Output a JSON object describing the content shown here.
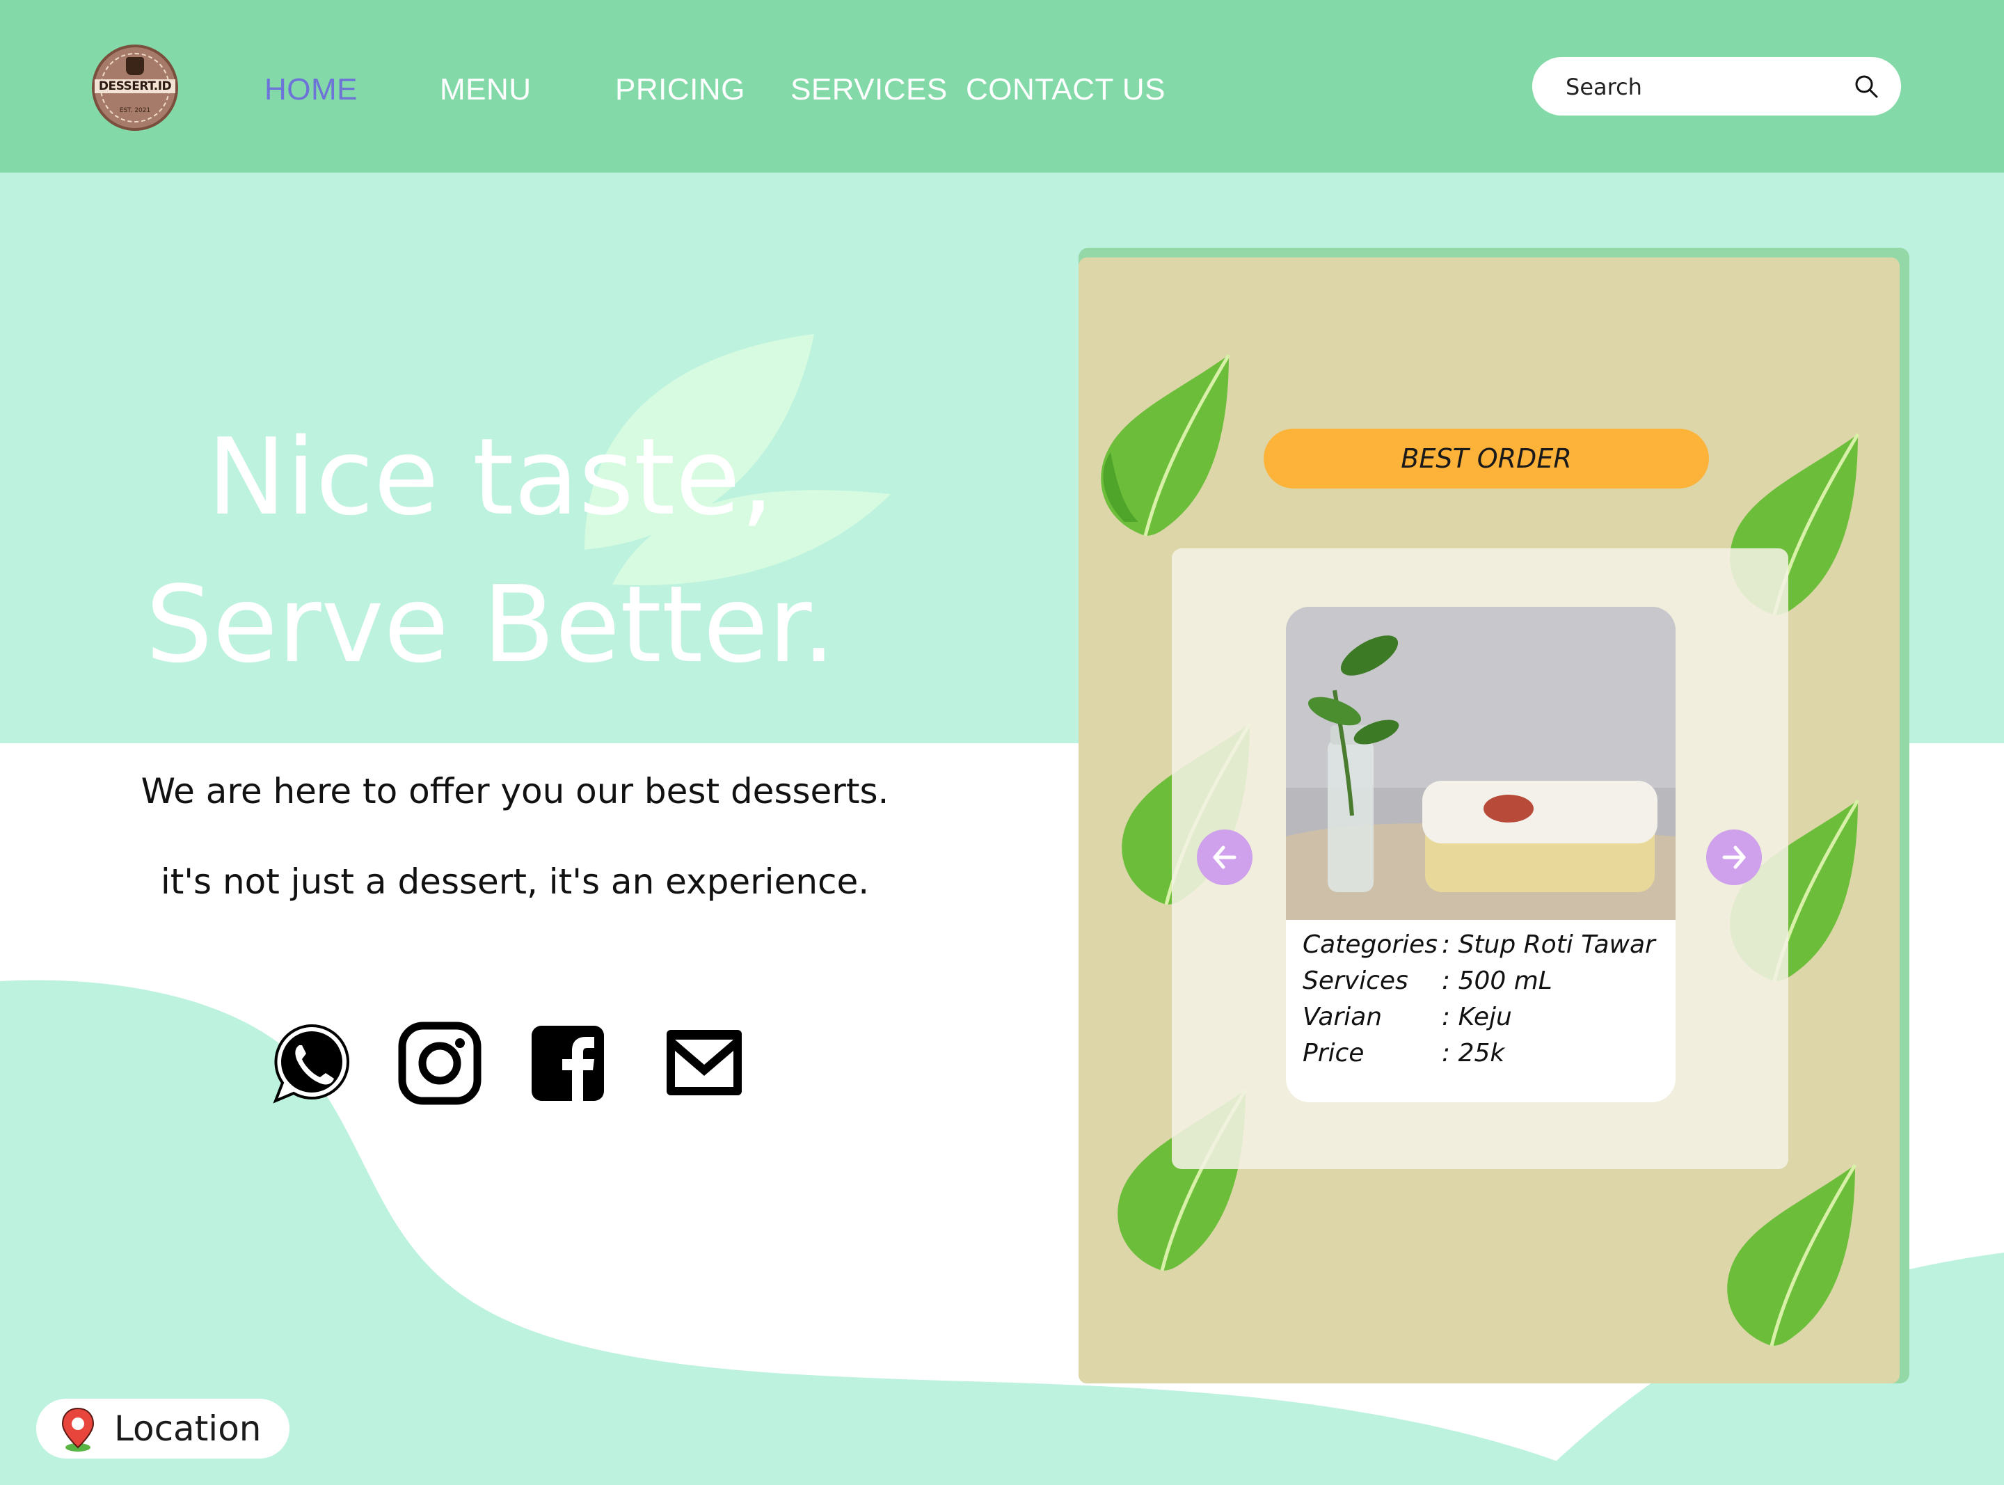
{
  "header": {
    "logo": {
      "text": "DESSERT.ID",
      "est": "EST. 2021"
    },
    "nav": [
      {
        "label": "HOME",
        "active": true
      },
      {
        "label": "MENU",
        "active": false
      },
      {
        "label": "PRICING",
        "active": false
      },
      {
        "label": "SERVICES",
        "active": false
      },
      {
        "label": "CONTACT US",
        "active": false
      }
    ],
    "search": {
      "placeholder": "Search",
      "icon": "search-icon"
    }
  },
  "hero": {
    "title_line1": "Nice taste,",
    "title_line2": "Serve Better.",
    "subtitle_line1": "We are here to offer you our best desserts.",
    "subtitle_line2": "it's not just a dessert, it's an experience."
  },
  "social": [
    {
      "icon": "whatsapp-icon"
    },
    {
      "icon": "instagram-icon"
    },
    {
      "icon": "facebook-icon"
    },
    {
      "icon": "email-icon"
    }
  ],
  "best_order": {
    "badge": "BEST ORDER",
    "product": {
      "rows": [
        {
          "label": "Categories",
          "value": ": Stup Roti Tawar"
        },
        {
          "label": "Services",
          "value": ": 500 mL"
        },
        {
          "label": "Varian",
          "value": ": Keju"
        },
        {
          "label": "Price",
          "value": ": 25k"
        }
      ]
    },
    "prev_icon": "arrow-left-icon",
    "next_icon": "arrow-right-icon"
  },
  "location": {
    "label": "Location",
    "icon": "map-pin-icon"
  },
  "colors": {
    "header": "#83daa8",
    "mint": "#bcf2de",
    "nav_active": "#6e73d8",
    "card": "#dcd6a8",
    "badge": "#fdb33a",
    "arrow": "#cfa0ec"
  }
}
